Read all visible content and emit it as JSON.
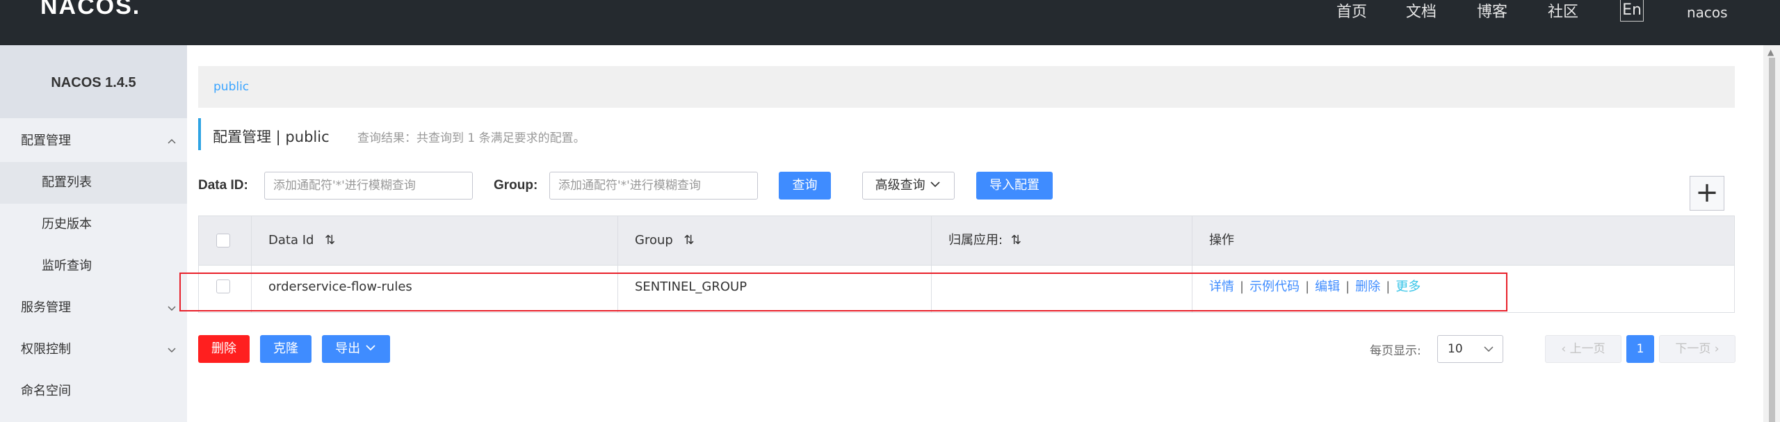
{
  "header": {
    "logo": "NACOS.",
    "nav": [
      "首页",
      "文档",
      "博客",
      "社区"
    ],
    "lang": "En",
    "user": "nacos"
  },
  "sidebar": {
    "brand": "NACOS 1.4.5",
    "items": [
      {
        "label": "配置管理",
        "icon": "chevron-up-icon"
      },
      {
        "label": "配置列表"
      },
      {
        "label": "历史版本"
      },
      {
        "label": "监听查询"
      },
      {
        "label": "服务管理",
        "icon": "chevron-down-icon"
      },
      {
        "label": "权限控制",
        "icon": "chevron-down-icon"
      },
      {
        "label": "命名空间"
      }
    ]
  },
  "breadcrumb": {
    "namespace": "public"
  },
  "title": {
    "text": "配置管理 | public",
    "query_result": "查询结果：共查询到 1 条满足要求的配置。"
  },
  "search": {
    "dataid_label": "Data ID:",
    "dataid_placeholder": "添加通配符'*'进行模糊查询",
    "group_label": "Group:",
    "group_placeholder": "添加通配符'*'进行模糊查询",
    "query_button": "查询",
    "advanced_button": "高级查询",
    "import_button": "导入配置",
    "add_icon": "plus-icon"
  },
  "table": {
    "columns": [
      "Data Id",
      "Group",
      "归属应用:",
      "操作"
    ],
    "rows": [
      {
        "data_id": "orderservice-flow-rules",
        "group": "SENTINEL_GROUP",
        "app": ""
      }
    ],
    "actions": [
      "详情",
      "示例代码",
      "编辑",
      "删除",
      "更多"
    ]
  },
  "footer": {
    "delete_button": "删除",
    "clone_button": "克隆",
    "export_button": "导出",
    "page_size_label": "每页显示:",
    "page_size": "10",
    "prev": "上一页",
    "current_page": "1",
    "next": "下一页"
  },
  "colors": {
    "primary": "#3f8cff",
    "danger": "#ff1f1f",
    "header_bg": "#252a2f",
    "highlight": "#e8202a"
  }
}
